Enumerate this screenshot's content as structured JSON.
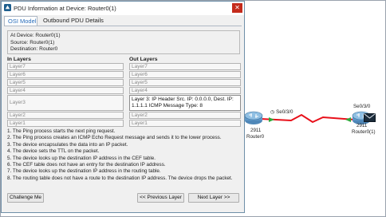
{
  "window": {
    "title": "PDU Information at Device: Router0(1)",
    "close_glyph": "✕",
    "icon": "packet-tracer-icon"
  },
  "tabs": [
    {
      "label": "OSI Model",
      "active": true
    },
    {
      "label": "Outbound PDU Details",
      "active": false
    }
  ],
  "info": {
    "line1": "At Device: Router0(1)",
    "line2": "Source: Router0(1)",
    "line3": "Destination: Router0"
  },
  "in_layers": {
    "header": "In Layers",
    "items": [
      "Layer7",
      "Layer6",
      "Layer5",
      "Layer4",
      "Layer3",
      "Layer2",
      "Layer1"
    ]
  },
  "out_layers": {
    "header": "Out Layers",
    "items": [
      "Layer7",
      "Layer6",
      "Layer5",
      "Layer4",
      "Layer 3: IP Header Src. IP: 0.0.0.0, Dest. IP: 1.1.1.1 ICMP Message Type: 8",
      "Layer2",
      "Layer1"
    ],
    "active_index": 4
  },
  "steps": [
    "1. The Ping process starts the next ping request.",
    "2. The Ping process creates an ICMP Echo Request message and sends it to the lower process.",
    "3. The device encapsulates the data into an IP packet.",
    "4. The device sets the TTL on the packet.",
    "5. The device looks up the destination IP address in the CEF table.",
    "6. The CEF table does not have an entry for the destination IP address.",
    "7. The device looks up the destination IP address in the routing table.",
    "8. The routing table does not have a route to the destination IP address. The device drops the packet."
  ],
  "buttons": {
    "challenge": "Challenge Me",
    "prev": "<< Previous Layer",
    "next": "Next Layer >>"
  },
  "topology": {
    "router0": {
      "model": "2911",
      "name": "Router0",
      "port": "Se0/3/0"
    },
    "router1": {
      "model": "2911",
      "name": "Router0(1)",
      "port": "Se0/3/0"
    },
    "link_color": "#e8101a",
    "pdu_icon": "envelope-icon"
  },
  "colors": {
    "tab_active_text": "#2a6ebb",
    "close_button": "#c42b1c",
    "link_status_up": "#2eaa3a"
  }
}
